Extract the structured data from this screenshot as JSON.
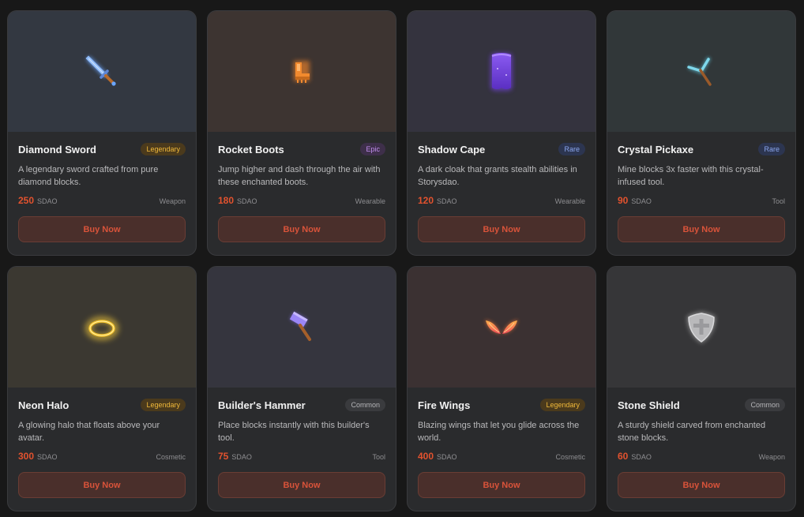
{
  "currency": "SDAO",
  "buy_label": "Buy Now",
  "items": [
    {
      "title": "Diamond Sword",
      "rarity": "Legendary",
      "description": "A legendary sword crafted from pure diamond blocks.",
      "price": "250",
      "category": "Weapon",
      "icon": "sword-icon",
      "bg": "#333841",
      "badge_bg": "#4b3a1c",
      "badge_color": "#f1b93a"
    },
    {
      "title": "Rocket Boots",
      "rarity": "Epic",
      "description": "Jump higher and dash through the air with these enchanted boots.",
      "price": "180",
      "category": "Wearable",
      "icon": "boots-icon",
      "bg": "#3d3431",
      "badge_bg": "#3e2f4a",
      "badge_color": "#c28ef0"
    },
    {
      "title": "Shadow Cape",
      "rarity": "Rare",
      "description": "A dark cloak that grants stealth abilities in Storysdao.",
      "price": "120",
      "category": "Wearable",
      "icon": "cape-icon",
      "bg": "#34333e",
      "badge_bg": "#2c3550",
      "badge_color": "#8ba7f0"
    },
    {
      "title": "Crystal Pickaxe",
      "rarity": "Rare",
      "description": "Mine blocks 3x faster with this crystal-infused tool.",
      "price": "90",
      "category": "Tool",
      "icon": "pickaxe-icon",
      "bg": "#313739",
      "badge_bg": "#2c3550",
      "badge_color": "#8ba7f0"
    },
    {
      "title": "Neon Halo",
      "rarity": "Legendary",
      "description": "A glowing halo that floats above your avatar.",
      "price": "300",
      "category": "Cosmetic",
      "icon": "halo-icon",
      "bg": "#3b3831",
      "badge_bg": "#4b3a1c",
      "badge_color": "#f1b93a"
    },
    {
      "title": "Builder's Hammer",
      "rarity": "Common",
      "description": "Place blocks instantly with this builder's tool.",
      "price": "75",
      "category": "Tool",
      "icon": "hammer-icon",
      "bg": "#35353e",
      "badge_bg": "#3a3b3e",
      "badge_color": "#b5b5b8"
    },
    {
      "title": "Fire Wings",
      "rarity": "Legendary",
      "description": "Blazing wings that let you glide across the world.",
      "price": "400",
      "category": "Cosmetic",
      "icon": "wings-icon",
      "bg": "#3b3132",
      "badge_bg": "#4b3a1c",
      "badge_color": "#f1b93a"
    },
    {
      "title": "Stone Shield",
      "rarity": "Common",
      "description": "A sturdy shield carved from enchanted stone blocks.",
      "price": "60",
      "category": "Weapon",
      "icon": "shield-icon",
      "bg": "#363638",
      "badge_bg": "#3a3b3e",
      "badge_color": "#b5b5b8"
    }
  ]
}
